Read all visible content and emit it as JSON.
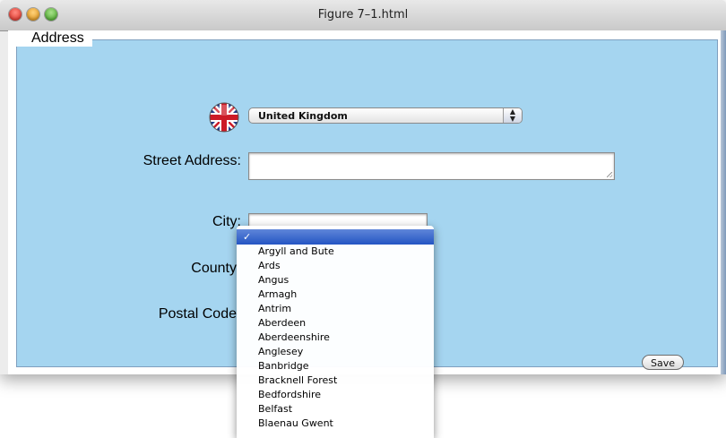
{
  "window": {
    "title": "Figure 7–1.html"
  },
  "form": {
    "legend": "Address",
    "country": {
      "selected": "United Kingdom",
      "flag_icon": "uk-flag-icon"
    },
    "street_label": "Street Address:",
    "city_label": "City:",
    "county_label": "County",
    "postal_label": "Postal Code",
    "save_label": "Save"
  },
  "county_dropdown": {
    "selected_mark": "✓",
    "options": [
      "Argyll and Bute",
      "Ards",
      "Angus",
      "Armagh",
      "Antrim",
      "Aberdeen",
      "Aberdeenshire",
      "Anglesey",
      "Banbridge",
      "Bracknell Forest",
      "Bedfordshire",
      "Belfast",
      "Blaenau Gwent"
    ]
  },
  "colors": {
    "fieldset_bg": "#a5d5f0",
    "highlight": "#2f5fc8"
  }
}
